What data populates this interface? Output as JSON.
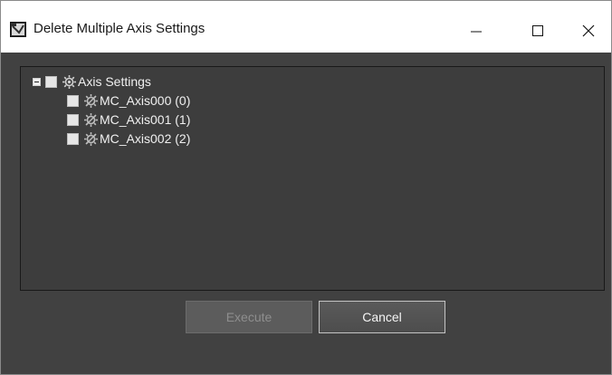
{
  "window": {
    "title": "Delete Multiple Axis Settings",
    "controls": {
      "minimize": "minimize-icon",
      "maximize": "maximize-icon",
      "close": "close-icon"
    }
  },
  "tree": {
    "root": {
      "label": "Axis Settings",
      "expanded": true,
      "checked": false,
      "icon": "gear-icon"
    },
    "children": [
      {
        "label": "MC_Axis000 (0)",
        "checked": false,
        "icon": "gear-icon"
      },
      {
        "label": "MC_Axis001 (1)",
        "checked": false,
        "icon": "gear-icon"
      },
      {
        "label": "MC_Axis002 (2)",
        "checked": false,
        "icon": "gear-icon"
      }
    ]
  },
  "buttons": {
    "execute": {
      "label": "Execute",
      "enabled": false
    },
    "cancel": {
      "label": "Cancel",
      "enabled": true
    }
  },
  "colors": {
    "client_bg": "#414141",
    "panel_bg": "#3d3d3d",
    "text": "#f0f0f0"
  }
}
